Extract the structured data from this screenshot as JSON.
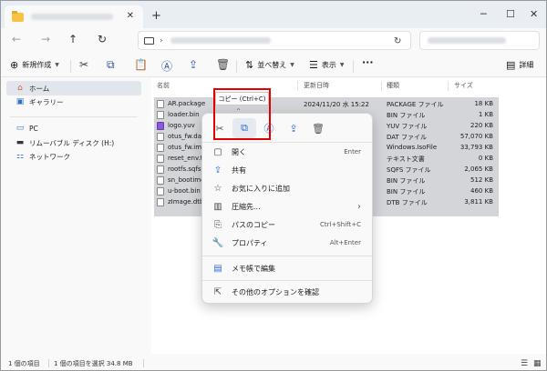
{
  "titlebar": {
    "close_glyph": "✕",
    "newtab_glyph": "+",
    "minimize_glyph": "─",
    "maximize_glyph": "☐",
    "window_close_glyph": "✕"
  },
  "nav": {
    "back": "←",
    "forward": "→",
    "up": "↑",
    "refresh": "↻",
    "address_chevron": "›"
  },
  "commandbar": {
    "new_label": "新規作成",
    "sort_label": "並べ替え",
    "view_label": "表示",
    "more_label": "···",
    "details_label": "詳細",
    "icons": {
      "new": "⊕",
      "cut": "✂",
      "copy": "⧉",
      "paste": "📋",
      "rename": "Ⓐ",
      "share": "⇪",
      "delete": "🗑",
      "sort": "⇅",
      "view": "☰",
      "details": "▤"
    }
  },
  "sidebar": {
    "items": [
      {
        "label": "ホーム",
        "icon": "home-icon",
        "glyph": "⌂",
        "selected": true
      },
      {
        "label": "ギャラリー",
        "icon": "gallery-icon",
        "glyph": "▣",
        "selected": false
      },
      {
        "label": "PC",
        "icon": "pc-icon",
        "glyph": "▭",
        "selected": false
      },
      {
        "label": "リムーバブル ディスク (H:)",
        "icon": "drive-icon",
        "glyph": "▬",
        "selected": false
      },
      {
        "label": "ネットワーク",
        "icon": "network-icon",
        "glyph": "⚏",
        "selected": false
      }
    ]
  },
  "filelist": {
    "columns": {
      "name": "名前",
      "date": "更新日時",
      "type": "種類",
      "size": "サイズ"
    },
    "sort_indicator": "^",
    "rows": [
      {
        "name": "AR.package",
        "date": "2024/11/20 水 15:22",
        "type": "PACKAGE ファイル",
        "size": "18 KB"
      },
      {
        "name": "loader.bin",
        "date": "",
        "type": "BIN ファイル",
        "size": "1 KB"
      },
      {
        "name": "logo.yuv",
        "date": "",
        "type": "YUV ファイル",
        "size": "220 KB"
      },
      {
        "name": "otus_fw.dat",
        "date": "",
        "type": "DAT ファイル",
        "size": "57,070 KB"
      },
      {
        "name": "otus_fw.img",
        "date": "",
        "type": "Windows.IsoFile",
        "size": "33,793 KB"
      },
      {
        "name": "reset_env.txt",
        "date": "",
        "type": "テキスト文書",
        "size": "0 KB"
      },
      {
        "name": "rootfs.sqfs",
        "date": "",
        "type": "SQFS ファイル",
        "size": "2,065 KB"
      },
      {
        "name": "sn_bootimg",
        "date": "",
        "type": "BIN ファイル",
        "size": "512 KB"
      },
      {
        "name": "u-boot.bin",
        "date": "",
        "type": "BIN ファイル",
        "size": "460 KB"
      },
      {
        "name": "zImage.dtb",
        "date": "",
        "type": "DTB ファイル",
        "size": "3,811 KB"
      }
    ]
  },
  "tooltip": {
    "text": "コピー (Ctrl+C)"
  },
  "context_menu": {
    "quick": {
      "cut": "✂",
      "copy": "⧉",
      "rename": "Ⓐ",
      "share": "⇪",
      "delete": "🗑"
    },
    "items": [
      {
        "label": "開く",
        "shortcut": "Enter",
        "glyph": "▢"
      },
      {
        "label": "共有",
        "shortcut": "",
        "glyph": "⇪"
      },
      {
        "label": "お気に入りに追加",
        "shortcut": "",
        "glyph": "☆"
      },
      {
        "label": "圧縮先...",
        "shortcut": "›",
        "glyph": "▥"
      },
      {
        "label": "パスのコピー",
        "shortcut": "Ctrl+Shift+C",
        "glyph": "⎘"
      },
      {
        "label": "プロパティ",
        "shortcut": "Alt+Enter",
        "glyph": "🔧"
      },
      {
        "label": "メモ帳で編集",
        "shortcut": "",
        "glyph": "▤"
      },
      {
        "label": "その他のオプションを確認",
        "shortcut": "",
        "glyph": "⇱"
      }
    ]
  },
  "statusbar": {
    "count": "1 個の項目",
    "selected": "1 個の項目を選択 34.8 MB",
    "icons": {
      "list": "☰",
      "tiles": "▦"
    }
  },
  "colors": {
    "highlight": "#e50000",
    "accent": "#2b6cd4",
    "selection": "#d3d5d9"
  }
}
